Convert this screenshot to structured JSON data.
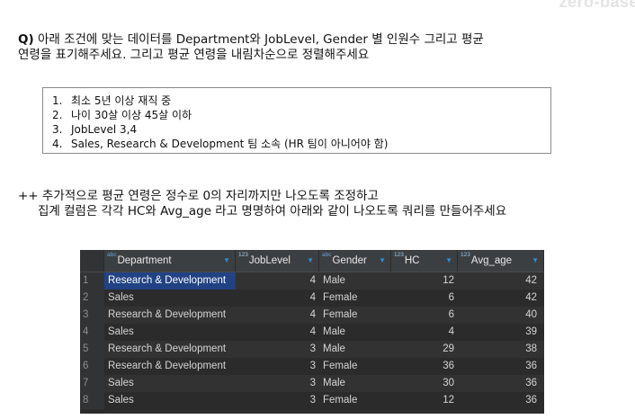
{
  "watermark": "zero-base",
  "question": {
    "prefix": "Q)",
    "line1": " 아래 조건에 맞는 데이터를 Department와 JobLevel, Gender 별 인원수 그리고 평균",
    "line2": "연령을 표기해주세요. 그리고 평균 연령을 내림차순으로 정렬해주세요"
  },
  "conditions": [
    {
      "num": "1.",
      "text": "최소 5년 이상 재직 중"
    },
    {
      "num": "2.",
      "text": "나이 30살 이상 45살 이하"
    },
    {
      "num": "3.",
      "text": "JobLevel 3,4"
    },
    {
      "num": "4.",
      "text": "Sales, Research & Development 팀 소속 (HR 팀이 아니어야 함)"
    }
  ],
  "note": {
    "line1": "++ 추가적으로 평균 연령은 정수로 0의 자리까지만 나오도록 조정하고",
    "line2": "집계 컬럼은 각각 HC와 Avg_age 라고 명명하여 아래와 같이 나오도록 쿼리를 만들어주세요"
  },
  "result_grid": {
    "columns": [
      {
        "name": "Department",
        "type": "abc"
      },
      {
        "name": "JobLevel",
        "type": "123"
      },
      {
        "name": "Gender",
        "type": "abc"
      },
      {
        "name": "HC",
        "type": "123"
      },
      {
        "name": "Avg_age",
        "type": "123"
      }
    ],
    "rows": [
      {
        "idx": "1",
        "department": "Research & Development",
        "joblevel": "4",
        "gender": "Male",
        "hc": "12",
        "avg_age": "42"
      },
      {
        "idx": "2",
        "department": "Sales",
        "joblevel": "4",
        "gender": "Female",
        "hc": "6",
        "avg_age": "42"
      },
      {
        "idx": "3",
        "department": "Research & Development",
        "joblevel": "4",
        "gender": "Female",
        "hc": "6",
        "avg_age": "40"
      },
      {
        "idx": "4",
        "department": "Sales",
        "joblevel": "4",
        "gender": "Male",
        "hc": "4",
        "avg_age": "39"
      },
      {
        "idx": "5",
        "department": "Research & Development",
        "joblevel": "3",
        "gender": "Male",
        "hc": "29",
        "avg_age": "38"
      },
      {
        "idx": "6",
        "department": "Research & Development",
        "joblevel": "3",
        "gender": "Female",
        "hc": "36",
        "avg_age": "36"
      },
      {
        "idx": "7",
        "department": "Sales",
        "joblevel": "3",
        "gender": "Male",
        "hc": "30",
        "avg_age": "36"
      },
      {
        "idx": "8",
        "department": "Sales",
        "joblevel": "3",
        "gender": "Female",
        "hc": "12",
        "avg_age": "36"
      }
    ]
  },
  "colors": {
    "grid_bg": "#2b2b2b",
    "header_bg": "#3c3f41",
    "selection": "#214283",
    "filter_icon": "#2f8bd6"
  }
}
